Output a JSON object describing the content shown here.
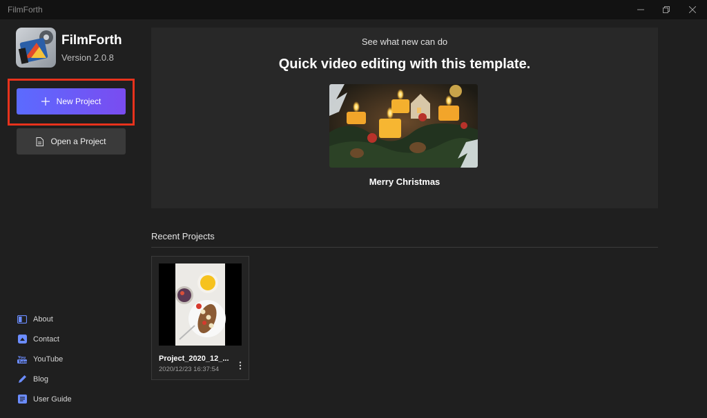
{
  "window": {
    "title": "FilmForth",
    "controls": [
      "minimize-icon",
      "restore-icon",
      "close-icon"
    ]
  },
  "app": {
    "name": "FilmForth",
    "version": "Version  2.0.8"
  },
  "actions": {
    "new_project": "New Project",
    "open_project": "Open a Project"
  },
  "sidebar_links": [
    {
      "label": "About",
      "icon": "book-icon"
    },
    {
      "label": "Contact",
      "icon": "contact-icon"
    },
    {
      "label": "YouTube",
      "icon": "youtube-icon"
    },
    {
      "label": "Blog",
      "icon": "pencil-icon"
    },
    {
      "label": "User Guide",
      "icon": "document-icon"
    }
  ],
  "banner": {
    "eyebrow": "See what new can do",
    "headline": "Quick video editing with this template.",
    "template_name": "Merry Christmas"
  },
  "recent": {
    "title": "Recent Projects",
    "projects": [
      {
        "name": "Project_2020_12_...",
        "date": "2020/12/23 16:37:54"
      }
    ]
  },
  "colors": {
    "accent_start": "#5b6bff",
    "accent_end": "#7a4cf0",
    "highlight": "#e8321c",
    "background": "#1f1f1f",
    "panel": "#282828"
  }
}
